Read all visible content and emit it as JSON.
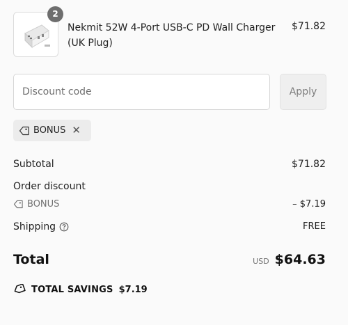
{
  "cart_item": {
    "quantity": "2",
    "name": "Nekmit 52W 4-Port USB-C PD Wall Charger (UK Plug)",
    "price": "$71.82"
  },
  "discount": {
    "placeholder": "Discount code",
    "apply_label": "Apply",
    "applied_code": "BONUS"
  },
  "summary": {
    "subtotal_label": "Subtotal",
    "subtotal_value": "$71.82",
    "order_discount_label": "Order discount",
    "discount_code": "BONUS",
    "discount_value": "– $7.19",
    "shipping_label": "Shipping",
    "shipping_value": "FREE",
    "total_label": "Total",
    "currency": "USD",
    "total_value": "$64.63",
    "savings_label": "TOTAL SAVINGS",
    "savings_value": "$7.19"
  },
  "icons": {
    "tag": "tag-icon",
    "close": "close-icon",
    "help": "help-circle-icon",
    "savings": "savings-tag-icon"
  }
}
